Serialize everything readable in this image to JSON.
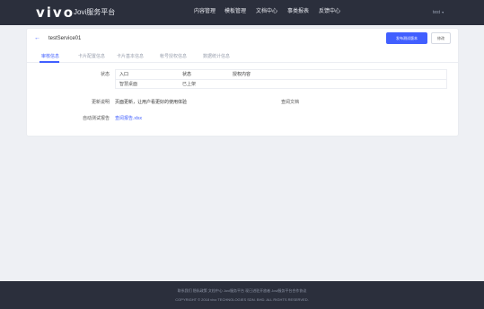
{
  "header": {
    "logo": "vivo",
    "brand": "Jovi服务平台",
    "nav": [
      "内容管理",
      "模板管理",
      "文档中心",
      "事类报表",
      "反馈中心"
    ],
    "user": "test",
    "caret": "▾"
  },
  "page": {
    "back_icon": "←",
    "title": "testService01",
    "primary_button": "发布测试版本",
    "edit_button": "修改"
  },
  "tabs": [
    "审核信息",
    "卡片配置信息",
    "卡片基本信息",
    "帐号授权信息",
    "数据统计信息"
  ],
  "detail": {
    "status_label": "状态",
    "status_table": {
      "headers": [
        "入口",
        "状态",
        "授权内容"
      ],
      "rows": [
        [
          "智慧桌面",
          "已上架",
          ""
        ]
      ]
    },
    "update_label": "更新说明",
    "update_text": "页面更新，让用户看更好的使用体验",
    "doc_link": "查阅文档",
    "test_report_label": "自动测试报告",
    "test_report_link": "查阅报告.xlsx"
  },
  "footer": {
    "line1": "联系我们  隐私政策  文档中心  Jovi服务平台  现已进驻开放者  Jovi服务平台合作协议",
    "line2": "COPYRIGHT © 2018 vivo TECHNOLOGIES SDN. BHD. ALL RIGHTS RESERVED."
  }
}
